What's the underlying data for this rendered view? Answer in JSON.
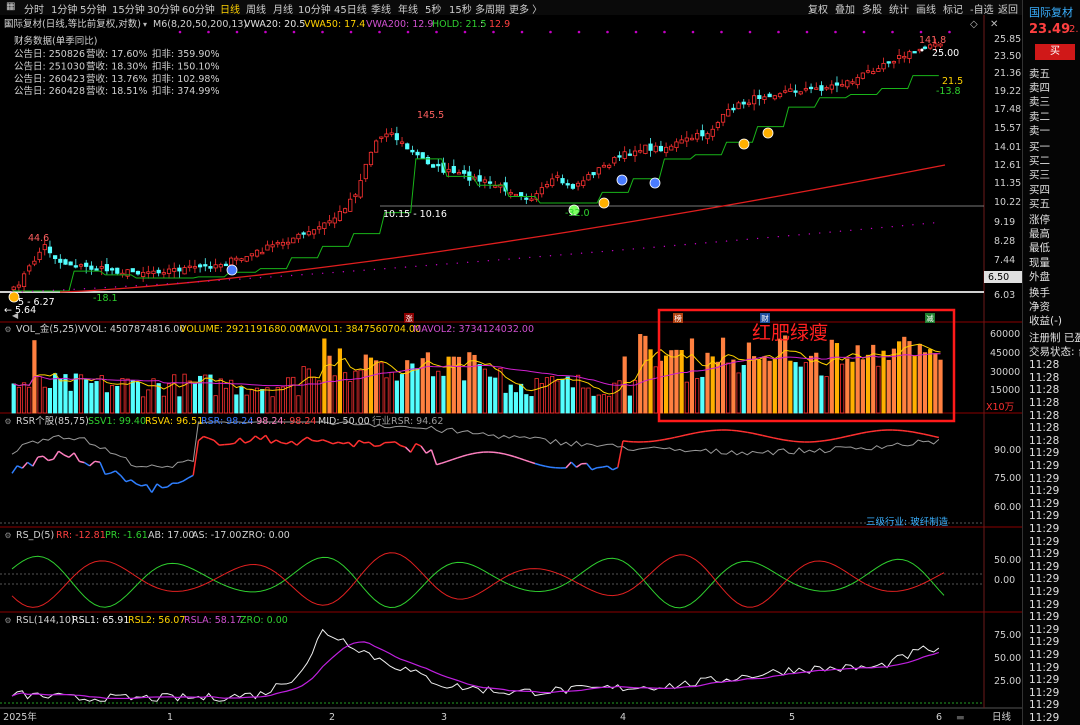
{
  "toolbar": {
    "periods": [
      "分时",
      "1分钟",
      "5分钟",
      "15分钟",
      "30分钟",
      "60分钟",
      "日线",
      "周线",
      "月线",
      "10分钟",
      "45日线",
      "季线",
      "年线",
      "5秒",
      "15秒",
      "多周期",
      "更多"
    ],
    "active": "日线",
    "right": [
      "复权",
      "叠加",
      "多股",
      "统计",
      "画线",
      "标记",
      "-自选",
      "返回"
    ]
  },
  "main": {
    "title": "国际复材(日线,等比前复权,对数)",
    "ma_label": "M6(8,20,50,200,13)",
    "vwa20": "VWA20: 20.5",
    "vwa50": "VWA50: 17.4",
    "vwa200": "VWA200: 12.9",
    "hold": "HOLD: 21.5",
    "hold2": "12.9",
    "fin_title": "财务数据(单季同比)",
    "fin_rows": [
      {
        "date": "公告日: 250826",
        "rev": "营收: 17.60%",
        "np": "扣非: 359.90%"
      },
      {
        "date": "公告日: 251030",
        "rev": "营收: 18.30%",
        "np": "扣非: 150.10%"
      },
      {
        "date": "公告日: 260423",
        "rev": "营收: 13.76%",
        "np": "扣非: 102.98%"
      },
      {
        "date": "公告日: 260428",
        "rev": "营收: 18.51%",
        "np": "扣非: 374.99%"
      }
    ],
    "price_axis": [
      "25.85",
      "23.50",
      "21.36",
      "19.22",
      "17.48",
      "15.57",
      "14.01",
      "12.61",
      "11.35",
      "10.22",
      "9.19",
      "8.28",
      "7.44",
      "6.50",
      "6.03"
    ],
    "ann": {
      "a446": "44.6",
      "a181": "-18.1",
      "a145": "145.5",
      "a1015": "10.15 - 10.16",
      "a320": "-32.0",
      "a1418": "141.8",
      "a2500": "25.00",
      "a215": "21.5",
      "a138": "-13.8",
      "a627": "5 - 6.27",
      "a564": "← 5.64"
    }
  },
  "vol": {
    "label": "VOL_金(5,25)",
    "vvol": "VVOL: 4507874816.00",
    "volume": "VOLUME: 2921191680.00",
    "mavol1": "MAVOL1: 3847560704.00",
    "mavol2": "MAVOL2: 3734124032.00",
    "axis": [
      "60000",
      "45000",
      "30000",
      "15000"
    ],
    "unit": "X10万",
    "box_text": "红肥绿瘦",
    "tags": {
      "t1": "榜",
      "t2": "财",
      "t3": "减",
      "t4": "涨"
    }
  },
  "rsr": {
    "label": "RSR个股(85,75)",
    "ssv1": "SSV1: 99.40",
    "rsva": "RSVA: 96.51",
    "rsr": "RSR: 98.24",
    "v1": ": 98.24",
    "v2": ": 98.24",
    "mid": "MID: 50.00",
    "ind": "行业RSR: 94.62",
    "axis": [
      "90.00",
      "75.00",
      "60.00"
    ],
    "industry": "三级行业: 玻纤制造"
  },
  "rsd": {
    "label": "RS_D(5)",
    "rr": "RR: -12.81",
    "pr": "PR: -1.61",
    "ab": "AB: 17.00",
    "as": "AS: -17.00",
    "zro": "ZRO: 0.00",
    "axis": [
      "50.00",
      "0.00"
    ]
  },
  "rsl": {
    "label": "RSL(144,10)",
    "rsl1": "RSL1: 65.91",
    "rsl2": "RSL2: 56.07",
    "rsla": "RSLA: 58.17",
    "zro": "ZRO: 0.00",
    "axis": [
      "75.00",
      "50.00",
      "25.00"
    ]
  },
  "xaxis": {
    "labels": [
      "2025年",
      "1",
      "2",
      "3",
      "4",
      "5",
      "6"
    ],
    "period": "日线"
  },
  "sidebar": {
    "name": "国际复材",
    "price": "23.49",
    "chg": "2.",
    "buy": "买",
    "sells": [
      "卖五",
      "卖四",
      "卖三",
      "卖二",
      "卖一"
    ],
    "buys": [
      "买一",
      "买二",
      "买三",
      "买四",
      "买五"
    ],
    "stats": [
      "涨停",
      "最高",
      "最低",
      "现量",
      "外盘"
    ],
    "stats2": [
      "换手",
      "净资",
      "收益(-)"
    ],
    "reg": "注册制 已盈",
    "status": "交易状态: 台",
    "times": [
      "11:28",
      "11:28",
      "11:28",
      "11:28",
      "11:28",
      "11:28",
      "11:28",
      "11:29",
      "11:29",
      "11:29",
      "11:29",
      "11:29",
      "11:29",
      "11:29",
      "11:29",
      "11:29",
      "11:29",
      "11:29",
      "11:29",
      "11:29",
      "11:29",
      "11:29",
      "11:29",
      "11:29",
      "11:29",
      "11:29",
      "11:29",
      "11:29",
      "11:29",
      "11:29",
      "11:29",
      "11:29",
      "11:29",
      "11:29",
      "11:29",
      "11:29",
      "11:29"
    ]
  },
  "colors": {
    "up": "#ff3232",
    "down": "#54ffff",
    "ma_green": "#19b419",
    "ma_red": "#e01e1e",
    "ma_purple": "#c400c4",
    "vol_orange": "#ff8040",
    "vol_gold": "#ffb000"
  }
}
